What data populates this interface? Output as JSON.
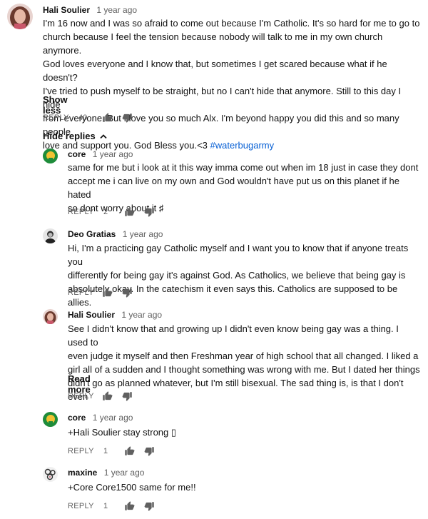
{
  "top_comment": {
    "author": "Hali Soulier",
    "time": "1 year ago",
    "lines": [
      "I'm 16 now and I was so afraid to come out because I'm Catholic. It's so hard for me to go to",
      "church because I feel the tension because nobody will talk to me in my own church anymore.",
      "God loves everyone and I know that, but sometimes I get scared because what if he doesn't?",
      "I've tried to push myself to be straight, but no I can't hide that anymore. Still to this day I hide",
      "from everyone. But I love you so much Alx. I'm beyond happy you did this and so many people",
      "love and support you. God Bless you.<3 "
    ],
    "hashtag": "#waterbugarmy",
    "show_less": "Show less",
    "reply_label": "REPLY",
    "likes": "40"
  },
  "hide_replies": "Hide replies",
  "replies": [
    {
      "author": "core",
      "time": "1 year ago",
      "lines": [
        "same for me but i look at it this way imma come out when im 18 just in case they dont",
        "accept me i can live on my own and God wouldn't have put us on this planet if he hated",
        "so dont worry about it ♯"
      ],
      "reply_label": "REPLY",
      "likes": "2"
    },
    {
      "author": "Deo Gratias",
      "time": "1 year ago",
      "lines": [
        "Hi, I'm a practicing gay Catholic myself and I want you to know that if anyone treats you",
        "differently for being gay it's against God. As Catholics, we believe that being gay is",
        "absolutely okay. In the catechism it even says this. Catholics are supposed to be allies."
      ],
      "reply_label": "REPLY",
      "likes": ""
    },
    {
      "author": "Hali Soulier",
      "time": "1 year ago",
      "lines": [
        "See I didn't know that and growing up I didn't even know being gay was a thing. I used to",
        "even judge it myself and then Freshman year of high school that all changed. I liked a",
        "girl all of a sudden and I thought something was wrong with me. But I dated her things",
        "didn't go as planned whatever, but I'm still bisexual. The sad thing is, is that I don't even"
      ],
      "read_more": "Read more",
      "reply_label": "REPLY",
      "likes": ""
    },
    {
      "author": "core",
      "time": "1 year ago",
      "lines": [
        "+Hali Soulier stay strong ▯"
      ],
      "reply_label": "REPLY",
      "likes": "1"
    },
    {
      "author": "maxine",
      "time": "1 year ago",
      "lines": [
        "+Core Core1500 same for me!!"
      ],
      "reply_label": "REPLY",
      "likes": "1"
    }
  ],
  "colors": {
    "link": "#065fd4",
    "muted": "#606060",
    "core_avatar": "#1e8c3a",
    "hali_avatar": "#c98b86"
  },
  "icons": [
    "thumbs-up-icon",
    "thumbs-down-icon",
    "chevron-up-icon"
  ]
}
